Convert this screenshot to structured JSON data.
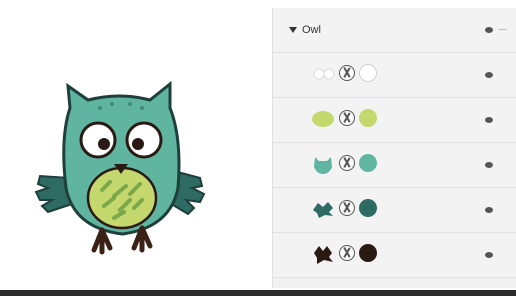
{
  "artwork": {
    "description_colors": {
      "body": "#5fb5a0",
      "body_dark": "#2e6b63",
      "belly": "#c5d86d",
      "belly_stripe": "#7aa84a",
      "outline": "#2a1a14",
      "feet": "#3a2216",
      "eye_white": "#ffffff"
    }
  },
  "layers_panel": {
    "group_name": "Owl",
    "group_icon": "caret-down-icon",
    "visibility_icon": "eye-icon",
    "rows": [
      {
        "thumb_icon": "highlight-thumb",
        "clip_icon": "clipping-mask-icon",
        "swatch_color": "#ffffff",
        "swatch_border": "#d0d0d0"
      },
      {
        "thumb_icon": "belly-thumb",
        "clip_icon": "clipping-mask-icon",
        "swatch_color": "#c5d86d",
        "swatch_border": "#c5d86d"
      },
      {
        "thumb_icon": "head-thumb",
        "clip_icon": "clipping-mask-icon",
        "swatch_color": "#5fb5a0",
        "swatch_border": "#5fb5a0"
      },
      {
        "thumb_icon": "wing-thumb",
        "clip_icon": "clipping-mask-icon",
        "swatch_color": "#2e6b63",
        "swatch_border": "#2e6b63"
      },
      {
        "thumb_icon": "outline-thumb",
        "clip_icon": "clipping-mask-icon",
        "swatch_color": "#2a1a14",
        "swatch_border": "#2a1a14"
      }
    ]
  }
}
